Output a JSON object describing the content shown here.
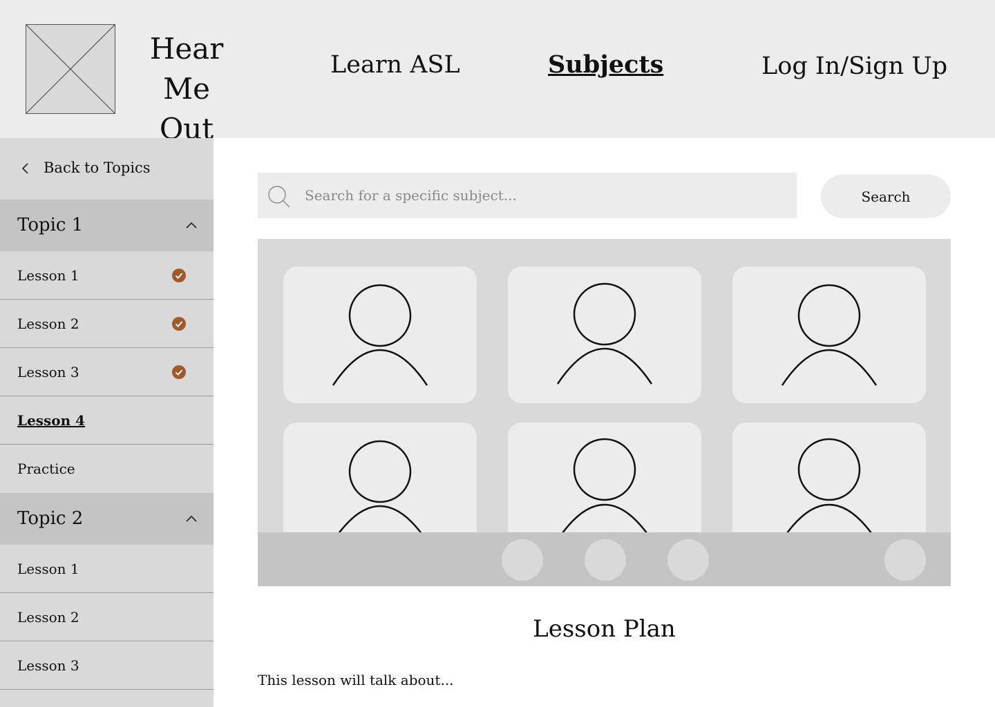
{
  "header": {
    "brand_line1": "Hear Me",
    "brand_line2": "Out",
    "nav": [
      {
        "label": "Learn ASL"
      },
      {
        "label": "Subjects"
      },
      {
        "label": "Log In/Sign Up"
      }
    ],
    "active_nav": "Subjects"
  },
  "sidebar": {
    "back_label": "Back to Topics",
    "topics": [
      {
        "label": "Topic 1",
        "expanded": true,
        "lessons": [
          {
            "label": "Lesson 1",
            "completed": true
          },
          {
            "label": "Lesson 2",
            "completed": true
          },
          {
            "label": "Lesson 3",
            "completed": true
          },
          {
            "label": "Lesson 4",
            "completed": false,
            "active": true
          },
          {
            "label": "Practice",
            "completed": false
          }
        ]
      },
      {
        "label": "Topic 2",
        "expanded": true,
        "lessons": [
          {
            "label": "Lesson 1"
          },
          {
            "label": "Lesson 2"
          },
          {
            "label": "Lesson 3"
          }
        ]
      }
    ]
  },
  "search": {
    "placeholder": "Search for a specific subject...",
    "value": "",
    "button_label": "Search"
  },
  "video": {
    "participant_count": 6,
    "control_count": 4
  },
  "lesson_plan": {
    "title": "Lesson Plan",
    "body": "This lesson will talk about..."
  },
  "colors": {
    "header_bg": "#ececec",
    "sidebar_bg": "#d9d9d9",
    "topic_bg": "#c4c4c4",
    "check_accent": "#a0592b"
  },
  "icons": {
    "logo": "placeholder-image-icon",
    "back": "chevron-left-icon",
    "collapse": "chevron-up-icon",
    "completed": "check-circle-icon",
    "search": "search-icon",
    "participant": "user-avatar-icon"
  }
}
